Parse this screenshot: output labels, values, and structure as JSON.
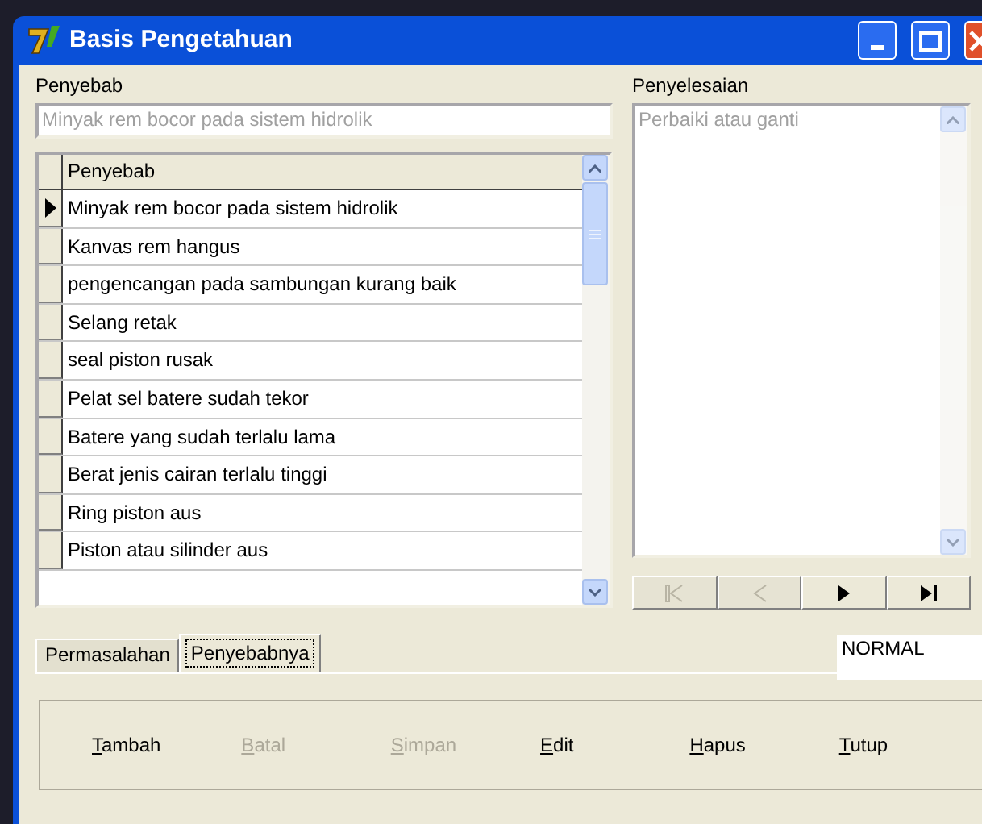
{
  "window": {
    "title": "Basis Pengetahuan"
  },
  "cause_label": "Penyebab",
  "cause_field": {
    "value": "Minyak rem bocor pada sistem hidrolik"
  },
  "solution_label": "Penyelesaian",
  "solution_field": {
    "value": "Perbaiki atau ganti"
  },
  "table": {
    "columns": [
      "Penyebab"
    ],
    "rows": [
      {
        "cells": [
          "Minyak rem bocor pada sistem hidrolik"
        ],
        "selected": true
      },
      {
        "cells": [
          "Kanvas rem hangus"
        ],
        "selected": false
      },
      {
        "cells": [
          "pengencangan pada sambungan kurang baik"
        ],
        "selected": false
      },
      {
        "cells": [
          "Selang retak"
        ],
        "selected": false
      },
      {
        "cells": [
          "seal piston rusak"
        ],
        "selected": false
      },
      {
        "cells": [
          "Pelat sel batere sudah tekor"
        ],
        "selected": false
      },
      {
        "cells": [
          "Batere yang sudah terlalu lama"
        ],
        "selected": false
      },
      {
        "cells": [
          "Berat jenis cairan terlalu tinggi"
        ],
        "selected": false
      },
      {
        "cells": [
          "Ring piston aus"
        ],
        "selected": false
      },
      {
        "cells": [
          "Piston atau silinder aus"
        ],
        "selected": false
      }
    ]
  },
  "navigator": [
    {
      "kind": "first",
      "disabled": true
    },
    {
      "kind": "prev",
      "disabled": true
    },
    {
      "kind": "next",
      "disabled": false
    },
    {
      "kind": "last",
      "disabled": false
    }
  ],
  "tabs": [
    {
      "label": "Permasalahan",
      "selected": false
    },
    {
      "label": "Penyebabnya",
      "selected": true
    }
  ],
  "mode": "NORMAL",
  "buttons": [
    {
      "label": "Tambah",
      "disabled": false
    },
    {
      "label": "Batal",
      "disabled": true
    },
    {
      "label": "Simpan",
      "disabled": true
    },
    {
      "label": "Edit",
      "disabled": false
    },
    {
      "label": "Hapus",
      "disabled": false
    },
    {
      "label": "Tutup",
      "disabled": false
    }
  ]
}
